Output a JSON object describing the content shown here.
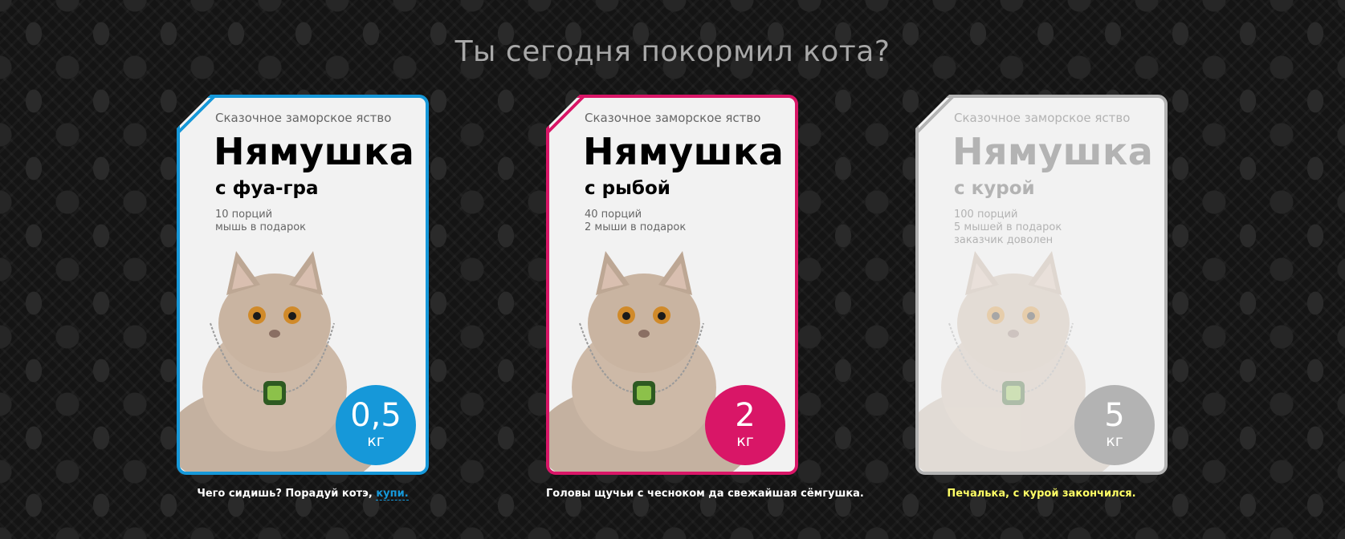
{
  "page": {
    "title": "Ты сегодня покормил кота?"
  },
  "colors": {
    "default": "#1698d9",
    "selected": "#d91667",
    "disabled": "#b3b3b3",
    "disabled_caption": "#ffff66"
  },
  "cards": [
    {
      "tagline": "Сказочное заморское яство",
      "brand": "Нямушка",
      "flavor": "с фуа-гра",
      "features": [
        "10 порций",
        "мышь в подарок"
      ],
      "weight": "0,5",
      "unit": "кг",
      "state": "default",
      "caption_text": "Чего сидишь? Порадуй котэ, ",
      "caption_link": "купи."
    },
    {
      "tagline": "Сказочное заморское яство",
      "brand": "Нямушка",
      "flavor": "с рыбой",
      "features": [
        "40 порций",
        "2 мыши в подарок"
      ],
      "weight": "2",
      "unit": "кг",
      "state": "selected",
      "caption_text": "Головы щучьи с чесноком да свежайшая сёмгушка."
    },
    {
      "tagline": "Сказочное заморское яство",
      "brand": "Нямушка",
      "flavor": "с курой",
      "features": [
        "100 порций",
        "5 мышей в подарок",
        "заказчик доволен"
      ],
      "weight": "5",
      "unit": "кг",
      "state": "disabled",
      "caption_text": "Печалька, с курой закончился."
    }
  ]
}
